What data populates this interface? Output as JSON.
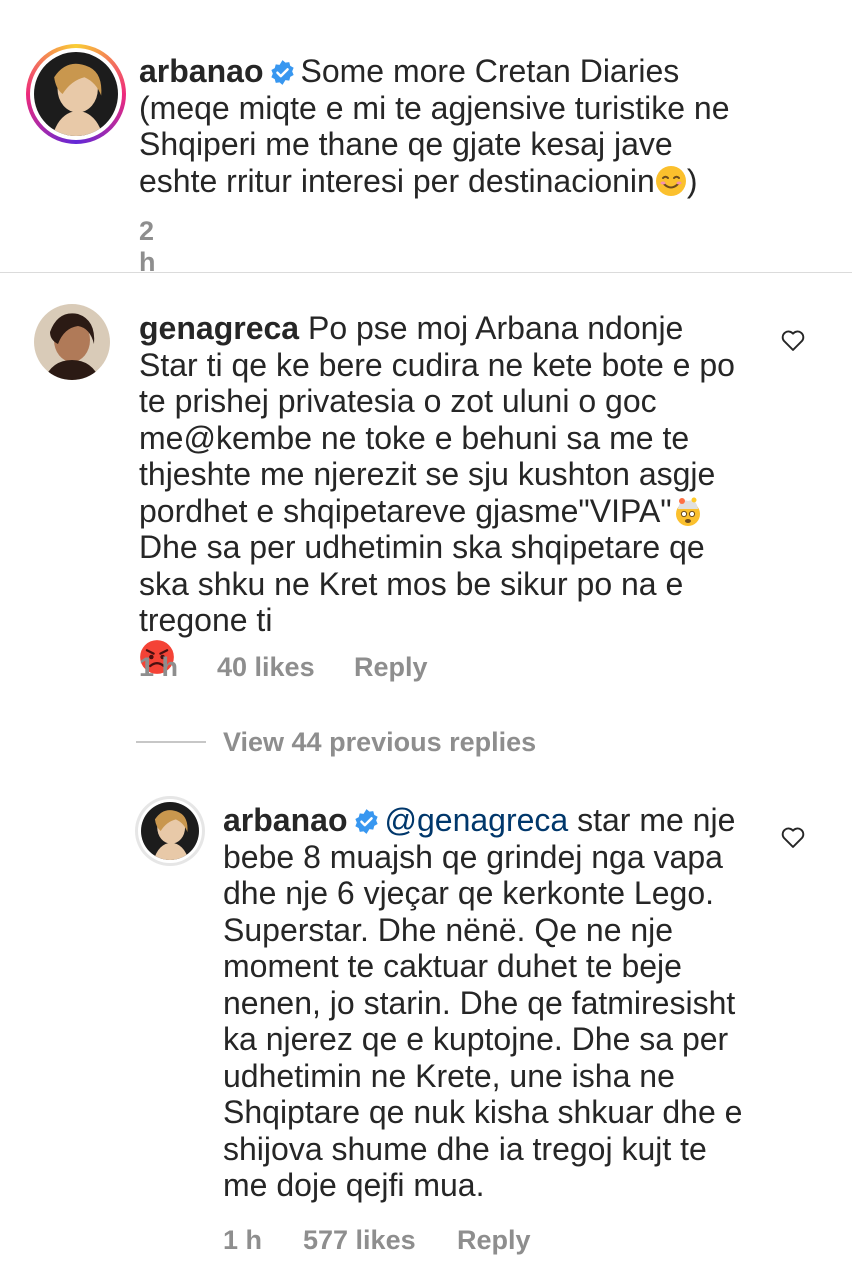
{
  "caption": {
    "username": "arbanao",
    "text": "Some more Cretan Diaries (meqe miqte e mi te agjensive turistike ne Shqiperi me thane qe gjate kesaj jave eshte rritur interesi per destinacionin",
    "text_end": ")",
    "time": "2 h"
  },
  "comment": {
    "username": "genagreca",
    "text_part1": "Po pse moj Arbana ndonje Star ti qe ke bere cudira ne kete bote e po te prishej privatesia o zot uluni o goc me@kembe ne toke e behuni sa me te thjeshte me njerezit se sju kushton asgje pordhet e shqipetareve gjasme\"VIPA\"",
    "text_part2": "Dhe sa per udhetimin ska shqipetare qe ska shku ne Kret mos be sikur po na e tregone ti",
    "time": "1 h",
    "likes": "40 likes",
    "reply": "Reply"
  },
  "view_replies": "View 44 previous replies",
  "reply": {
    "username": "arbanao",
    "mention": "@genagreca",
    "text": "star me nje bebe 8 muajsh qe grindej nga vapa dhe nje 6 vjeçar qe kerkonte Lego. Superstar. Dhe nënë. Qe ne nje moment te caktuar duhet te beje nenen, jo starin. Dhe qe fatmiresisht ka njerez qe e kuptojne. Dhe sa per udhetimin ne Krete, une isha ne Shqiptare qe nuk kisha shkuar dhe e shijova shume dhe ia tregoj kujt te me doje qejfi mua.",
    "time": "1 h",
    "likes": "577 likes",
    "reply": "Reply"
  },
  "colors": {
    "verified": "#3897f0",
    "meta": "#8e8e8e",
    "mention": "#00376b",
    "divider": "#dbdbdb"
  }
}
